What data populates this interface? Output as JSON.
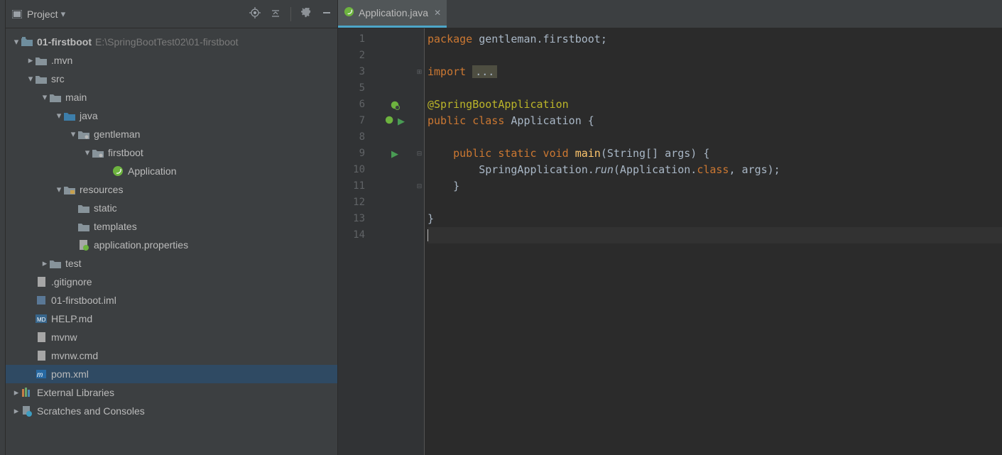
{
  "sidebar": {
    "project_label": "Project",
    "root_name": "01-firstboot",
    "root_path": "E:\\SpringBootTest02\\01-firstboot",
    "items": {
      "mvn": ".mvn",
      "src": "src",
      "main": "main",
      "java": "java",
      "gentleman": "gentleman",
      "firstboot": "firstboot",
      "application": "Application",
      "resources": "resources",
      "static": "static",
      "templates": "templates",
      "app_props": "application.properties",
      "test": "test",
      "gitignore": ".gitignore",
      "iml": "01-firstboot.iml",
      "help": "HELP.md",
      "mvnw": "mvnw",
      "mvnw_cmd": "mvnw.cmd",
      "pom": "pom.xml",
      "ext_lib": "External Libraries",
      "scratches": "Scratches and Consoles"
    }
  },
  "tab": {
    "label": "Application.java"
  },
  "editor": {
    "line_numbers": [
      "1",
      "2",
      "3",
      "5",
      "6",
      "7",
      "8",
      "9",
      "10",
      "11",
      "12",
      "13",
      "14"
    ],
    "line1_kw": "package",
    "line1_rest": " gentleman.firstboot;",
    "line3_kw": "import",
    "line3_dots": "...",
    "line6_ann": "@SpringBootApplication",
    "line7_kw": "public class",
    "line7_class": " Application {",
    "line9_kw": "public static void",
    "line9_fn": " main",
    "line9_args": "(String[] args) {",
    "line10a": "        SpringApplication.",
    "line10b": "run",
    "line10c": "(Application.",
    "line10d": "class",
    "line10e": ", args);",
    "line11": "    }",
    "line13": "}"
  }
}
